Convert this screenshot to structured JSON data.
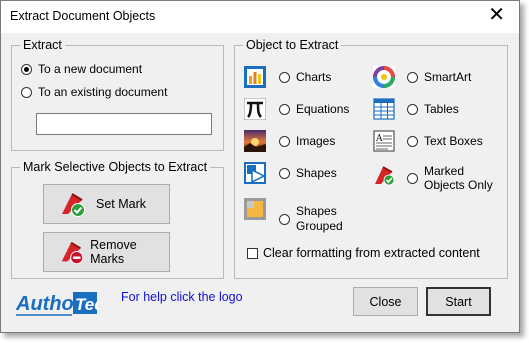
{
  "window": {
    "title": "Extract Document Objects",
    "close_symbol": "✕"
  },
  "extract": {
    "legend": "Extract",
    "options": [
      {
        "label": "To a new document",
        "selected": true
      },
      {
        "label": "To an existing document",
        "selected": false
      }
    ],
    "path_value": ""
  },
  "mark": {
    "legend": "Mark Selective Objects to Extract",
    "set_label": "Set Mark",
    "remove_label": "Remove Marks"
  },
  "objects": {
    "legend": "Object to Extract",
    "items": [
      {
        "label": "Charts",
        "icon": "chart-icon"
      },
      {
        "label": "Equations",
        "icon": "equation-icon"
      },
      {
        "label": "Images",
        "icon": "image-icon"
      },
      {
        "label": "Shapes",
        "icon": "shapes-icon"
      },
      {
        "label": "Shapes Grouped",
        "icon": "shapes-grouped-icon"
      },
      {
        "label": "SmartArt",
        "icon": "smartart-icon"
      },
      {
        "label": "Tables",
        "icon": "table-icon"
      },
      {
        "label": "Text Boxes",
        "icon": "textbox-icon"
      },
      {
        "label": "Marked Objects Only",
        "icon": "marked-objects-icon"
      }
    ],
    "clear_formatting_label": "Clear formatting from extracted content",
    "clear_formatting_checked": false
  },
  "footer": {
    "logo_text": "AuthorTec",
    "help_text": "For help click the logo",
    "close_label": "Close",
    "start_label": "Start"
  },
  "colors": {
    "accent_blue": "#1a6ebf",
    "link_blue": "#1010d0",
    "mark_red": "#d6242a",
    "check_green": "#2f9e3a"
  }
}
